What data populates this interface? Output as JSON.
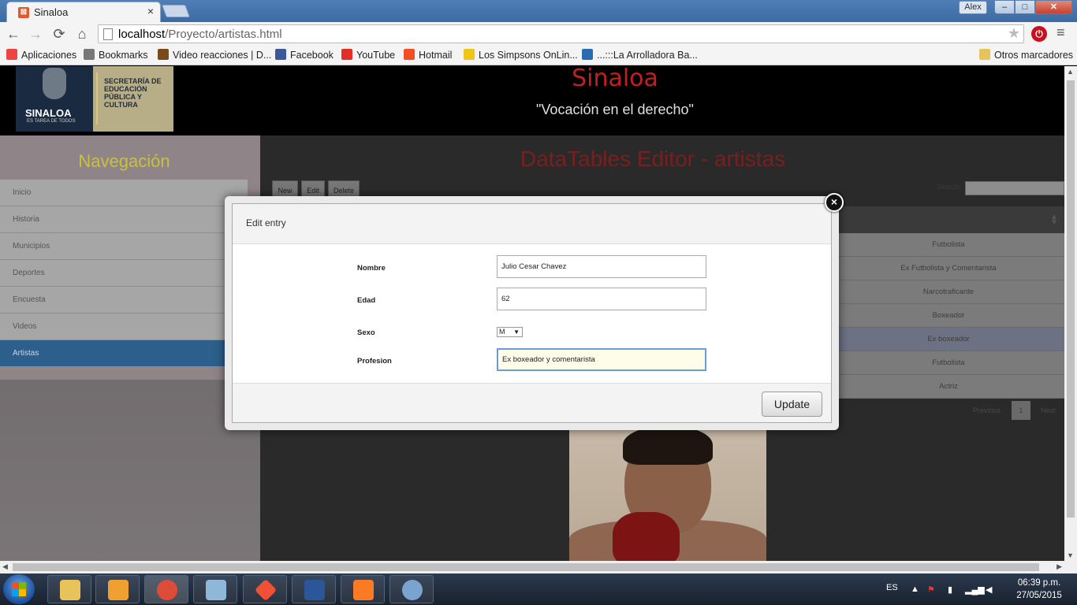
{
  "browser": {
    "tab_title": "Sinaloa",
    "tab_close": "×",
    "user_badge": "Alex",
    "window_buttons": {
      "minimize": "–",
      "maximize": "□",
      "close": "✕"
    },
    "url_host": "localhost",
    "url_path": "/Proyecto/artistas.html",
    "nav": {
      "back": "←",
      "forward": "→",
      "reload": "⟳",
      "home": "⌂"
    },
    "star": "★",
    "menu": "≡",
    "bookmarks": [
      {
        "label": "Aplicaciones",
        "icon": "apps-grid-icon",
        "color": "#e44"
      },
      {
        "label": "Bookmarks",
        "icon": "star-icon",
        "color": "#777"
      },
      {
        "label": "Video reacciones | D...",
        "icon": "site-icon",
        "color": "#7a4a1a"
      },
      {
        "label": "Facebook",
        "icon": "facebook-icon",
        "color": "#3b5998"
      },
      {
        "label": "YouTube",
        "icon": "youtube-icon",
        "color": "#e52d27"
      },
      {
        "label": "Hotmail",
        "icon": "windows-icon",
        "color": "#f25022"
      },
      {
        "label": "Los Simpsons OnLin...",
        "icon": "simpsons-icon",
        "color": "#f0c419"
      },
      {
        "label": "...:::La Arrolladora Ba...",
        "icon": "globe-icon",
        "color": "#2a6ab0"
      }
    ],
    "other_bookmarks": "Otros marcadores"
  },
  "page": {
    "logo": {
      "name": "SINALOA",
      "tagline": "ES TAREA DE TODOS",
      "department": "SECRETARÍA DE EDUCACIÓN PÚBLICA Y CULTURA"
    },
    "site_title": "Sinaloa",
    "slogan": "\"Vocación en el derecho\"",
    "nav_title": "Navegación",
    "nav_items": [
      "Inicio",
      "Historia",
      "Municipios",
      "Deportes",
      "Encuesta",
      "Videos",
      "Artistas"
    ],
    "active_nav": "Artistas",
    "datatable": {
      "title": "DataTables Editor - artistas",
      "buttons": {
        "new": "New",
        "edit": "Edit",
        "delete": "Delete"
      },
      "search_label": "Search:",
      "column_cells": [
        "Futbolista",
        "Ex Futbolista y Comentarista",
        "Narcotraficante",
        "Boxeador",
        "Ex boxeador",
        "Futbolista",
        "Actriz"
      ],
      "selected_row": "Ex boxeador",
      "pagination": {
        "previous": "Previous",
        "page": "1",
        "next": "Next"
      }
    }
  },
  "modal": {
    "title": "Edit entry",
    "close": "×",
    "fields": {
      "nombre_label": "Nombre",
      "nombre_value": "Julio Cesar Chavez",
      "edad_label": "Edad",
      "edad_value": "62",
      "sexo_label": "Sexo",
      "sexo_value": "M",
      "profesion_label": "Profesion",
      "profesion_value": "Ex boxeador y comentarista"
    },
    "update_button": "Update"
  },
  "taskbar": {
    "apps": [
      {
        "name": "file-explorer-icon",
        "color": "#e8c25a"
      },
      {
        "name": "media-player-icon",
        "color": "#f0a030"
      },
      {
        "name": "chrome-icon",
        "color": "#dd4b39"
      },
      {
        "name": "notepad-icon",
        "color": "#8fb8d8"
      },
      {
        "name": "git-icon",
        "color": "#f05033"
      },
      {
        "name": "word-icon",
        "color": "#2b579a"
      },
      {
        "name": "xampp-icon",
        "color": "#fb7a24"
      },
      {
        "name": "paint-icon",
        "color": "#7aa3d0"
      }
    ],
    "language": "ES",
    "time": "06:39 p.m.",
    "date": "27/05/2015"
  }
}
